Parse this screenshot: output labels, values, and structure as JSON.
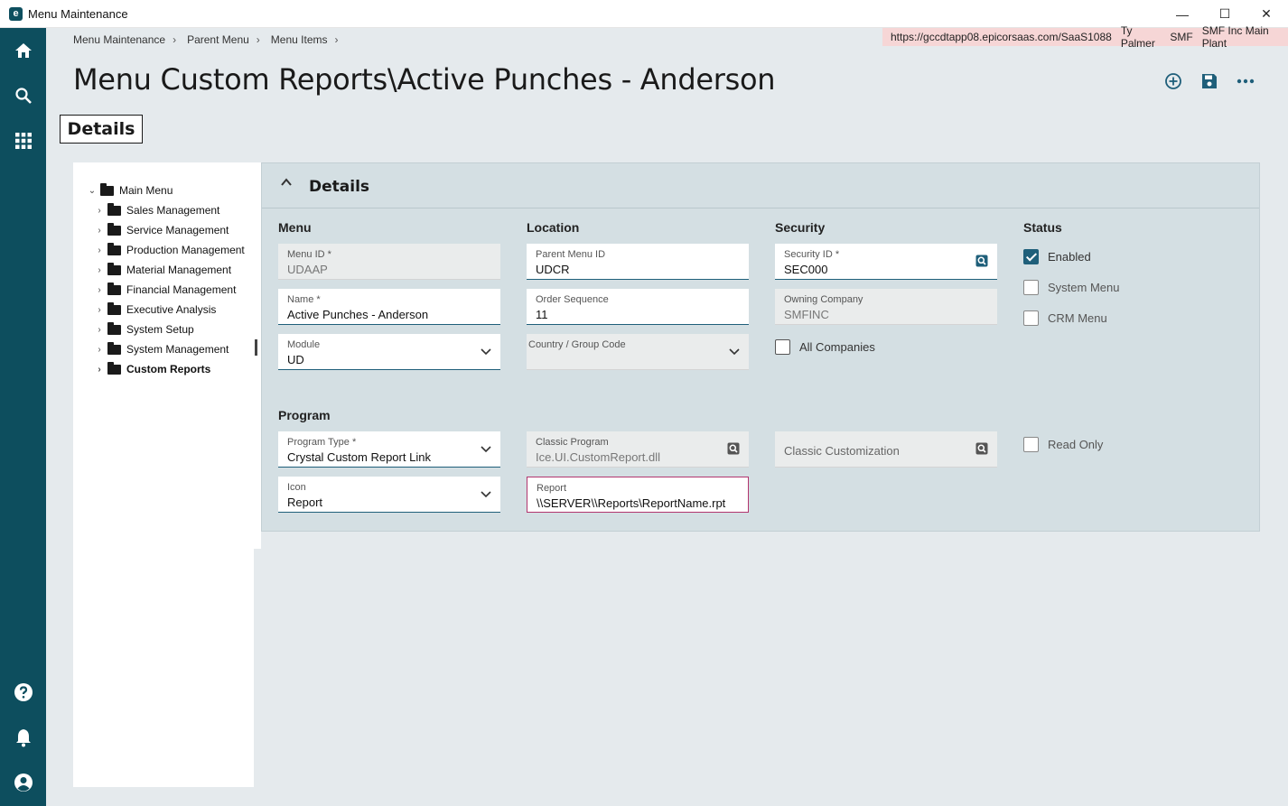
{
  "window": {
    "title": "Menu Maintenance",
    "minimize": "—",
    "maximize": "☐",
    "close": "✕"
  },
  "breadcrumb": [
    "Menu Maintenance",
    "Parent Menu",
    "Menu Items"
  ],
  "context": {
    "url": "https://gccdtapp08.epicorsaas.com/SaaS1088",
    "user": "Ty Palmer",
    "company": "SMF",
    "plant": "SMF Inc Main Plant"
  },
  "page_title": "Menu Custom Reports\\Active Punches - Anderson",
  "details_tab": "Details",
  "tree": {
    "root": "Main Menu",
    "items": [
      "Sales Management",
      "Service Management",
      "Production Management",
      "Material Management",
      "Financial Management",
      "Executive Analysis",
      "System Setup",
      "System Management",
      "Custom Reports"
    ]
  },
  "panel": {
    "title": "Details",
    "sections": {
      "menu": "Menu",
      "location": "Location",
      "security": "Security",
      "status": "Status",
      "program": "Program"
    },
    "fields": {
      "menu_id": {
        "label": "Menu ID *",
        "value": "UDAAP"
      },
      "name": {
        "label": "Name *",
        "value": "Active Punches - Anderson"
      },
      "module": {
        "label": "Module",
        "value": "UD"
      },
      "parent_menu_id": {
        "label": "Parent Menu ID",
        "value": "UDCR"
      },
      "order_sequence": {
        "label": "Order Sequence",
        "value": "11"
      },
      "country_group_code": {
        "label": "Country / Group Code",
        "value": ""
      },
      "security_id": {
        "label": "Security ID *",
        "value": "SEC000"
      },
      "owning_company": {
        "label": "Owning Company",
        "value": "SMFINC"
      },
      "program_type": {
        "label": "Program Type *",
        "value": "Crystal Custom Report Link"
      },
      "icon": {
        "label": "Icon",
        "value": "Report"
      },
      "classic_program": {
        "label": "Classic Program",
        "value": "Ice.UI.CustomReport.dll"
      },
      "report": {
        "label": "Report",
        "value": "\\\\SERVER\\\\Reports\\ReportName.rpt"
      },
      "classic_customization": {
        "label": "Classic Customization",
        "value": ""
      }
    },
    "checkboxes": {
      "all_companies": {
        "label": "All Companies",
        "checked": false
      },
      "enabled": {
        "label": "Enabled",
        "checked": true
      },
      "system_menu": {
        "label": "System Menu",
        "checked": false
      },
      "crm_menu": {
        "label": "CRM Menu",
        "checked": false
      },
      "read_only": {
        "label": "Read Only",
        "checked": false
      }
    }
  },
  "colors": {
    "rail": "#0d4e5e",
    "accent": "#1f5f7a",
    "focus_border": "#b2356e",
    "context_bg": "#f6d6d6"
  }
}
